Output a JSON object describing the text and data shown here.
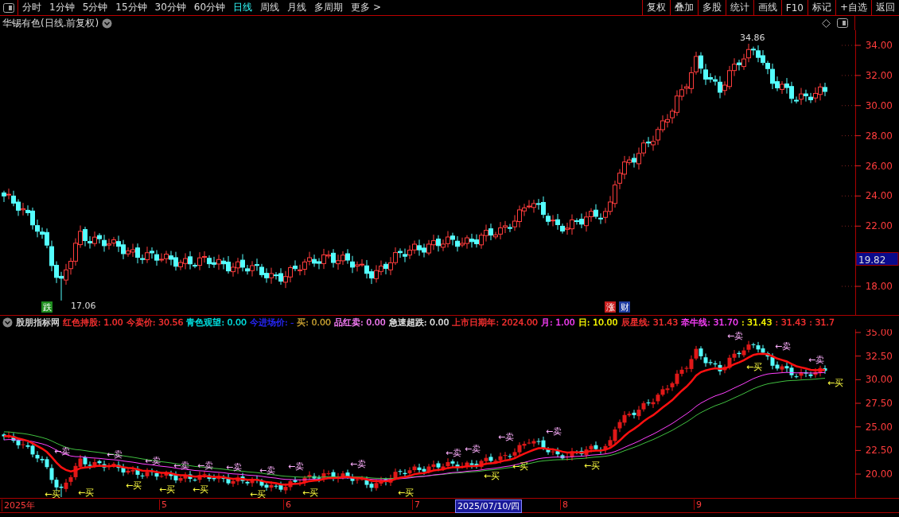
{
  "toolbar": {
    "periods": [
      {
        "label": "分时",
        "selected": false
      },
      {
        "label": "1分钟",
        "selected": false
      },
      {
        "label": "5分钟",
        "selected": false
      },
      {
        "label": "15分钟",
        "selected": false
      },
      {
        "label": "30分钟",
        "selected": false
      },
      {
        "label": "60分钟",
        "selected": false
      },
      {
        "label": "日线",
        "selected": true
      },
      {
        "label": "周线",
        "selected": false
      },
      {
        "label": "月线",
        "selected": false
      },
      {
        "label": "多周期",
        "selected": false
      },
      {
        "label": "更多 >",
        "selected": false
      }
    ],
    "actions": [
      "复权",
      "叠加",
      "多股",
      "统计",
      "画线",
      "F10",
      "标记",
      "+自选",
      "返回"
    ]
  },
  "main_chart": {
    "title": "华锡有色(日线.前复权)",
    "yticks": [
      "34.00",
      "32.00",
      "30.00",
      "28.00",
      "26.00",
      "24.00",
      "22.00",
      "18.00"
    ],
    "price_tag": "19.82",
    "high_label": "34.86",
    "low_label": "17.06",
    "markers": [
      {
        "label": "跌",
        "color": "#1e8c1e"
      },
      {
        "label": "涨",
        "color": "#c81e1e"
      },
      {
        "label": "财",
        "color": "#1e3ca0"
      }
    ]
  },
  "indicator": {
    "name": "股朋指标网",
    "legend": [
      {
        "label": "红色持股: 1.00",
        "color": "#ff3232"
      },
      {
        "label": "今卖价: 30.56",
        "color": "#ff3232"
      },
      {
        "label": "青色观望: 0.00",
        "color": "#00e6e6"
      },
      {
        "label": "今进场价: -",
        "color": "#2828ff"
      },
      {
        "label": "买: 0.00",
        "color": "#c8a032"
      },
      {
        "label": "品红卖: 0.00",
        "color": "#ff80ff"
      },
      {
        "label": "急速超跌: 0.00",
        "color": "#e6e6e6"
      },
      {
        "label": "上市日期年: 2024.00",
        "color": "#ff3232"
      },
      {
        "label": "月: 1.00",
        "color": "#ff40ff"
      },
      {
        "label": "日: 10.00",
        "color": "#ffff00"
      },
      {
        "label": "辰星线: 31.43",
        "color": "#ff3232"
      },
      {
        "label": "牵牛线: 31.70",
        "color": "#ff40ff"
      },
      {
        "label": ": 31.43",
        "color": "#ffff00"
      },
      {
        "label": ": 31.43",
        "color": "#ff3232"
      },
      {
        "label": ": 31.7",
        "color": "#ff3232"
      }
    ],
    "yticks": [
      "35.00",
      "32.50",
      "30.00",
      "27.50",
      "25.00",
      "22.50",
      "20.00"
    ],
    "signals": [
      {
        "label": "←卖",
        "kind": "sell"
      },
      {
        "label": "←买",
        "kind": "buy"
      },
      {
        "label": "←买",
        "kind": "buy"
      },
      {
        "label": "←卖",
        "kind": "sell"
      },
      {
        "label": "←买",
        "kind": "buy"
      },
      {
        "label": "←卖",
        "kind": "sell"
      },
      {
        "label": "←买",
        "kind": "buy"
      },
      {
        "label": "←卖",
        "kind": "sell"
      },
      {
        "label": "←买",
        "kind": "buy"
      },
      {
        "label": "←卖",
        "kind": "sell"
      },
      {
        "label": "←卖",
        "kind": "sell"
      },
      {
        "label": "←买",
        "kind": "buy"
      },
      {
        "label": "←卖",
        "kind": "sell"
      },
      {
        "label": "←卖",
        "kind": "sell"
      },
      {
        "label": "←买",
        "kind": "buy"
      },
      {
        "label": "←卖",
        "kind": "sell"
      },
      {
        "label": "←买",
        "kind": "buy"
      },
      {
        "label": "←卖",
        "kind": "sell"
      },
      {
        "label": "←卖",
        "kind": "sell"
      },
      {
        "label": "←买",
        "kind": "buy"
      },
      {
        "label": "←卖",
        "kind": "sell"
      },
      {
        "label": "←买",
        "kind": "buy"
      },
      {
        "label": "←卖",
        "kind": "sell"
      },
      {
        "label": "←买",
        "kind": "buy"
      },
      {
        "label": "←卖",
        "kind": "sell"
      },
      {
        "label": "←买",
        "kind": "buy"
      },
      {
        "label": "←卖",
        "kind": "sell"
      },
      {
        "label": "←卖",
        "kind": "sell"
      },
      {
        "label": "←买",
        "kind": "buy"
      }
    ]
  },
  "date_axis": {
    "labels": [
      {
        "label": "2025年",
        "selected": false
      },
      {
        "label": "5",
        "selected": false
      },
      {
        "label": "6",
        "selected": false
      },
      {
        "label": "7",
        "selected": false
      },
      {
        "label": "2025/07/10/四",
        "selected": true
      },
      {
        "label": "8",
        "selected": false
      },
      {
        "label": "9",
        "selected": false
      }
    ]
  }
}
